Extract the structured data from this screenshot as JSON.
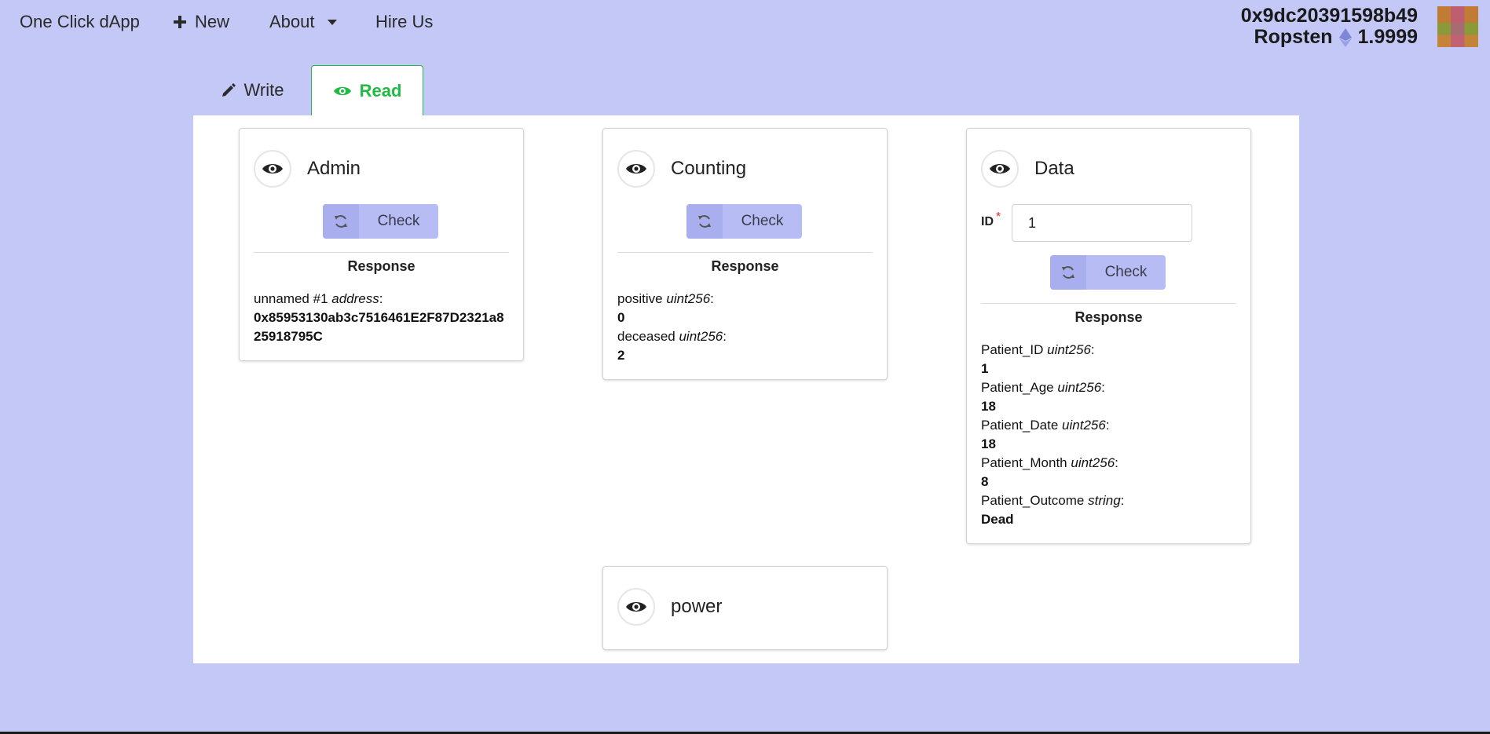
{
  "nav": {
    "brand": "One Click dApp",
    "new_label": "New",
    "about_label": "About",
    "hire_label": "Hire Us"
  },
  "account": {
    "address": "0x9dc20391598b49",
    "network": "Ropsten",
    "balance": "1.9999"
  },
  "tabs": {
    "write": "Write",
    "read": "Read"
  },
  "cards": {
    "admin": {
      "title": "Admin",
      "check_label": "Check",
      "response_title": "Response",
      "fields": [
        {
          "name": "unnamed #1",
          "type": "address",
          "value": "0x85953130ab3c7516461E2F87D2321a825918795C"
        }
      ]
    },
    "counting": {
      "title": "Counting",
      "check_label": "Check",
      "response_title": "Response",
      "fields": [
        {
          "name": "positive",
          "type": "uint256",
          "value": "0"
        },
        {
          "name": "deceased",
          "type": "uint256",
          "value": "2"
        }
      ]
    },
    "data": {
      "title": "Data",
      "id_label": "ID",
      "id_value": "1",
      "check_label": "Check",
      "response_title": "Response",
      "fields": [
        {
          "name": "Patient_ID",
          "type": "uint256",
          "value": "1"
        },
        {
          "name": "Patient_Age",
          "type": "uint256",
          "value": "18"
        },
        {
          "name": "Patient_Date",
          "type": "uint256",
          "value": "18"
        },
        {
          "name": "Patient_Month",
          "type": "uint256",
          "value": "8"
        },
        {
          "name": "Patient_Outcome",
          "type": "string",
          "value": "Dead"
        }
      ]
    },
    "power": {
      "title": "power"
    }
  },
  "colors": {
    "background": "#c3c8f6",
    "accent_green": "#21ba45",
    "button": "#b7bdf4"
  }
}
